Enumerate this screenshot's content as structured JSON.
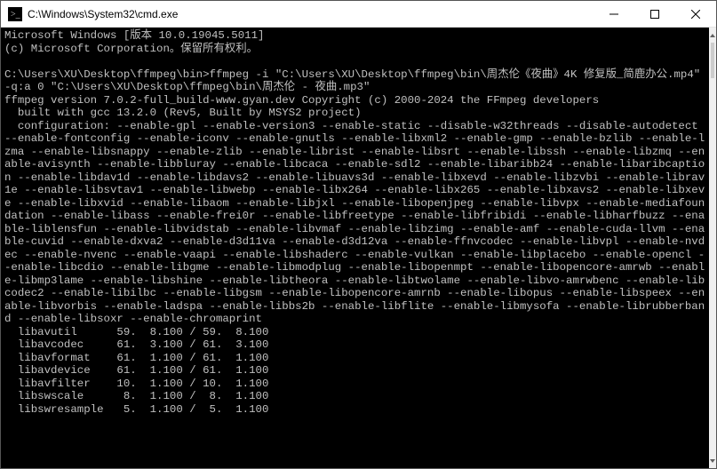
{
  "window": {
    "title": "C:\\Windows\\System32\\cmd.exe"
  },
  "terminal": {
    "lines": [
      "Microsoft Windows [版本 10.0.19045.5011]",
      "(c) Microsoft Corporation。保留所有权利。",
      "",
      "C:\\Users\\XU\\Desktop\\ffmpeg\\bin>ffmpeg -i \"C:\\Users\\XU\\Desktop\\ffmpeg\\bin\\周杰伦《夜曲》4K 修复版_简鹿办公.mp4\" -q:a 0 \"C:\\Users\\XU\\Desktop\\ffmpeg\\bin\\周杰伦 - 夜曲.mp3\"",
      "ffmpeg version 7.0.2-full_build-www.gyan.dev Copyright (c) 2000-2024 the FFmpeg developers",
      "  built with gcc 13.2.0 (Rev5, Built by MSYS2 project)",
      "  configuration: --enable-gpl --enable-version3 --enable-static --disable-w32threads --disable-autodetect --enable-fontconfig --enable-iconv --enable-gnutls --enable-libxml2 --enable-gmp --enable-bzlib --enable-lzma --enable-libsnappy --enable-zlib --enable-librist --enable-libsrt --enable-libssh --enable-libzmq --enable-avisynth --enable-libbluray --enable-libcaca --enable-sdl2 --enable-libaribb24 --enable-libaribcaption --enable-libdav1d --enable-libdavs2 --enable-libuavs3d --enable-libxevd --enable-libzvbi --enable-librav1e --enable-libsvtav1 --enable-libwebp --enable-libx264 --enable-libx265 --enable-libxavs2 --enable-libxeve --enable-libxvid --enable-libaom --enable-libjxl --enable-libopenjpeg --enable-libvpx --enable-mediafoundation --enable-libass --enable-frei0r --enable-libfreetype --enable-libfribidi --enable-libharfbuzz --enable-liblensfun --enable-libvidstab --enable-libvmaf --enable-libzimg --enable-amf --enable-cuda-llvm --enable-cuvid --enable-dxva2 --enable-d3d11va --enable-d3d12va --enable-ffnvcodec --enable-libvpl --enable-nvdec --enable-nvenc --enable-vaapi --enable-libshaderc --enable-vulkan --enable-libplacebo --enable-opencl --enable-libcdio --enable-libgme --enable-libmodplug --enable-libopenmpt --enable-libopencore-amrwb --enable-libmp3lame --enable-libshine --enable-libtheora --enable-libtwolame --enable-libvo-amrwbenc --enable-libcodec2 --enable-libilbc --enable-libgsm --enable-libopencore-amrnb --enable-libopus --enable-libspeex --enable-libvorbis --enable-ladspa --enable-libbs2b --enable-libflite --enable-libmysofa --enable-librubberband --enable-libsoxr --enable-chromaprint",
      "  libavutil      59.  8.100 / 59.  8.100",
      "  libavcodec     61.  3.100 / 61.  3.100",
      "  libavformat    61.  1.100 / 61.  1.100",
      "  libavdevice    61.  1.100 / 61.  1.100",
      "  libavfilter    10.  1.100 / 10.  1.100",
      "  libswscale      8.  1.100 /  8.  1.100",
      "  libswresample   5.  1.100 /  5.  1.100"
    ]
  }
}
